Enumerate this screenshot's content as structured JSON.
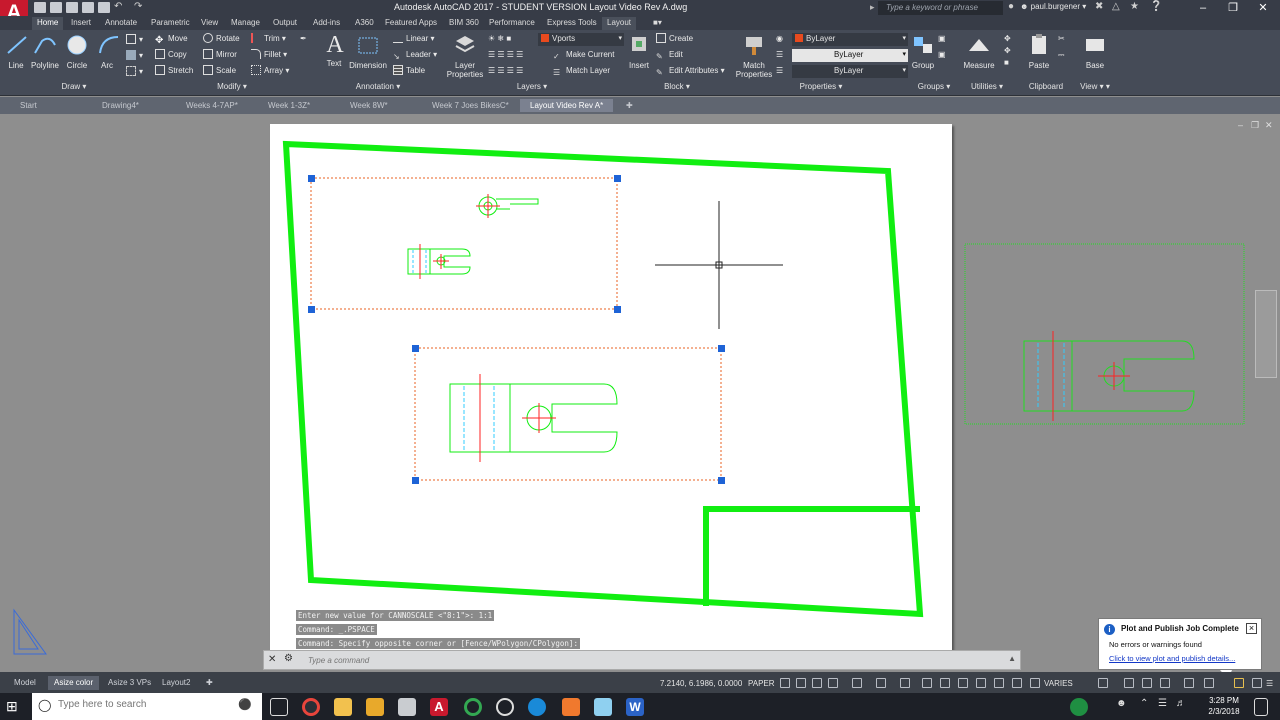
{
  "app": {
    "logo": "A",
    "title": "Autodesk AutoCAD 2017 - STUDENT VERSION    Layout Video Rev A.dwg",
    "search_placeholder": "Type a keyword or phrase",
    "user": "paul.burgener"
  },
  "ribbon_tabs": [
    "Home",
    "Insert",
    "Annotate",
    "Parametric",
    "View",
    "Manage",
    "Output",
    "Add-ins",
    "A360",
    "Featured Apps",
    "BIM 360",
    "Performance",
    "Express Tools",
    "Layout"
  ],
  "ribbon": {
    "draw": {
      "title": "Draw",
      "line": "Line",
      "polyline": "Polyline",
      "circle": "Circle",
      "arc": "Arc"
    },
    "modify": {
      "title": "Modify",
      "move": "Move",
      "rotate": "Rotate",
      "trim": "Trim",
      "copy": "Copy",
      "mirror": "Mirror",
      "fillet": "Fillet",
      "stretch": "Stretch",
      "scale": "Scale",
      "array": "Array"
    },
    "annotation": {
      "title": "Annotation",
      "text": "Text",
      "dimension": "Dimension",
      "linear": "Linear",
      "leader": "Leader",
      "table": "Table"
    },
    "layers": {
      "title": "Layers",
      "layer_properties": "Layer Properties",
      "current_layer": "Vports",
      "make_current": "Make Current",
      "match_layer": "Match Layer"
    },
    "block": {
      "title": "Block",
      "insert": "Insert",
      "create": "Create",
      "edit": "Edit",
      "edit_attributes": "Edit Attributes"
    },
    "properties": {
      "title": "Properties",
      "match_properties": "Match Properties",
      "color": "ByLayer",
      "linetype": "ByLayer",
      "lineweight": "ByLayer"
    },
    "groups": {
      "title": "Groups",
      "group": "Group"
    },
    "utilities": {
      "title": "Utilities",
      "measure": "Measure"
    },
    "clipboard": {
      "title": "Clipboard",
      "paste": "Paste"
    },
    "view": {
      "title": "View",
      "base": "Base"
    }
  },
  "doc_tabs": [
    "Start",
    "Drawing4*",
    "Weeks 4-7AP*",
    "Week 1-3Z*",
    "Week 8W*",
    "Week 7 Joes BikesC*",
    "Layout Video Rev A*"
  ],
  "command_history": [
    "Enter new value for CANNOSCALE <\"8:1\">: 1:1",
    "Command: _.PSPACE",
    "Command: Specify opposite corner or [Fence/WPolygon/CPolygon]:"
  ],
  "command_placeholder": "Type a command",
  "layout_tabs": [
    "Model",
    "Asize color",
    "Asize 3 VPs",
    "Layout2"
  ],
  "status": {
    "coords": "7.2140, 6.1986, 0.0000",
    "space": "PAPER",
    "scale": "VARIES"
  },
  "toast": {
    "title": "Plot and Publish Job Complete",
    "message": "No errors or warnings found",
    "link": "Click to view plot and publish details..."
  },
  "taskbar": {
    "search_placeholder": "Type here to search",
    "time": "3:28 PM",
    "date": "2/3/2018"
  },
  "colors": {
    "accent_red": "#c8192e",
    "drawing_green": "#11ee11",
    "selection_blue": "#1e63d6",
    "paper": "#ffffff"
  }
}
